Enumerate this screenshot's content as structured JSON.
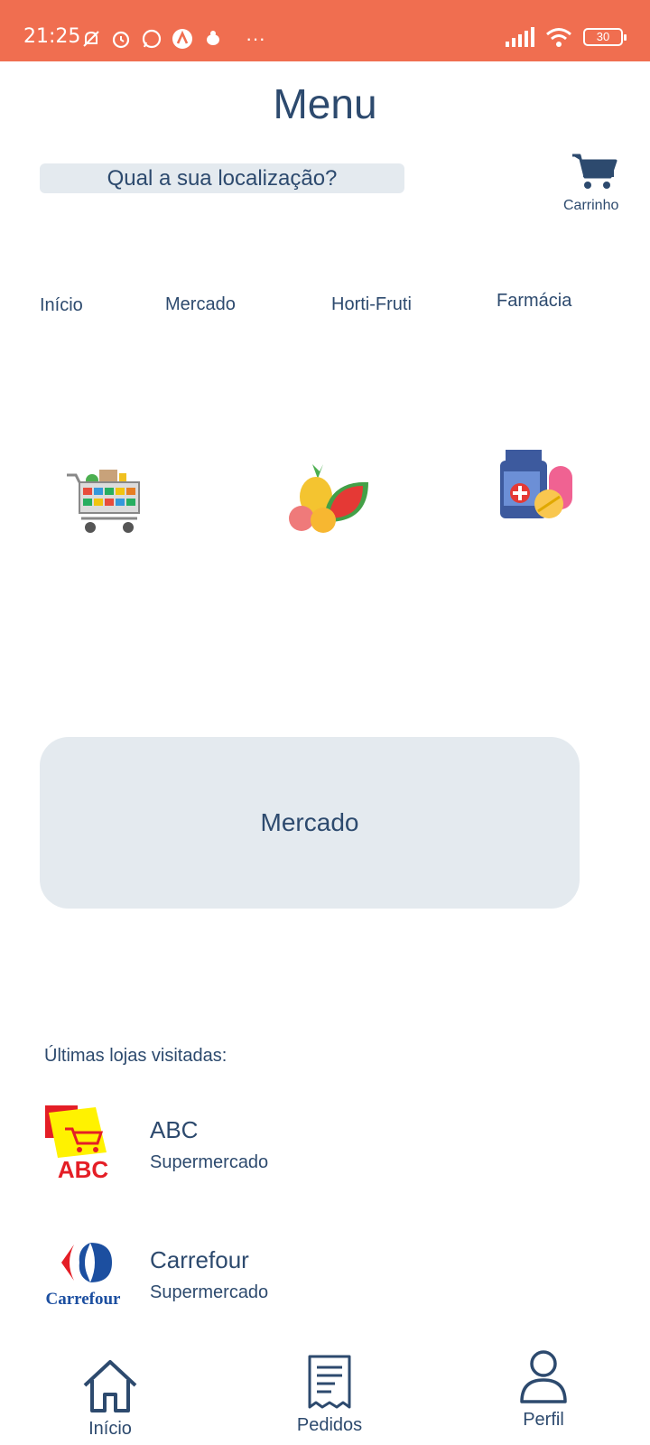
{
  "status_bar": {
    "time": "21:25",
    "battery": "30"
  },
  "header": {
    "title": "Menu"
  },
  "location": {
    "label": "Qual a sua localização?"
  },
  "cart": {
    "label": "Carrinho",
    "icon": "cart-icon"
  },
  "categories": [
    {
      "label": "Início"
    },
    {
      "label": "Mercado",
      "icon": "grocery-cart-icon"
    },
    {
      "label": "Horti-Fruti",
      "icon": "fruits-icon"
    },
    {
      "label": "Farmácia",
      "icon": "medicine-icon"
    }
  ],
  "banner": {
    "label": "Mercado"
  },
  "recent": {
    "heading": "Últimas lojas visitadas:",
    "stores": [
      {
        "name": "ABC",
        "type": "Supermercado",
        "logo_text": "ABC"
      },
      {
        "name": "Carrefour",
        "type": "Supermercado",
        "logo_text": "Carrefour"
      }
    ]
  },
  "bottom_nav": [
    {
      "label": "Início",
      "icon": "home-icon"
    },
    {
      "label": "Pedidos",
      "icon": "receipt-icon"
    },
    {
      "label": "Perfil",
      "icon": "user-icon"
    }
  ],
  "colors": {
    "status_bar": "#f06e50",
    "text": "#2d4a6e",
    "surface": "#e4eaef"
  }
}
